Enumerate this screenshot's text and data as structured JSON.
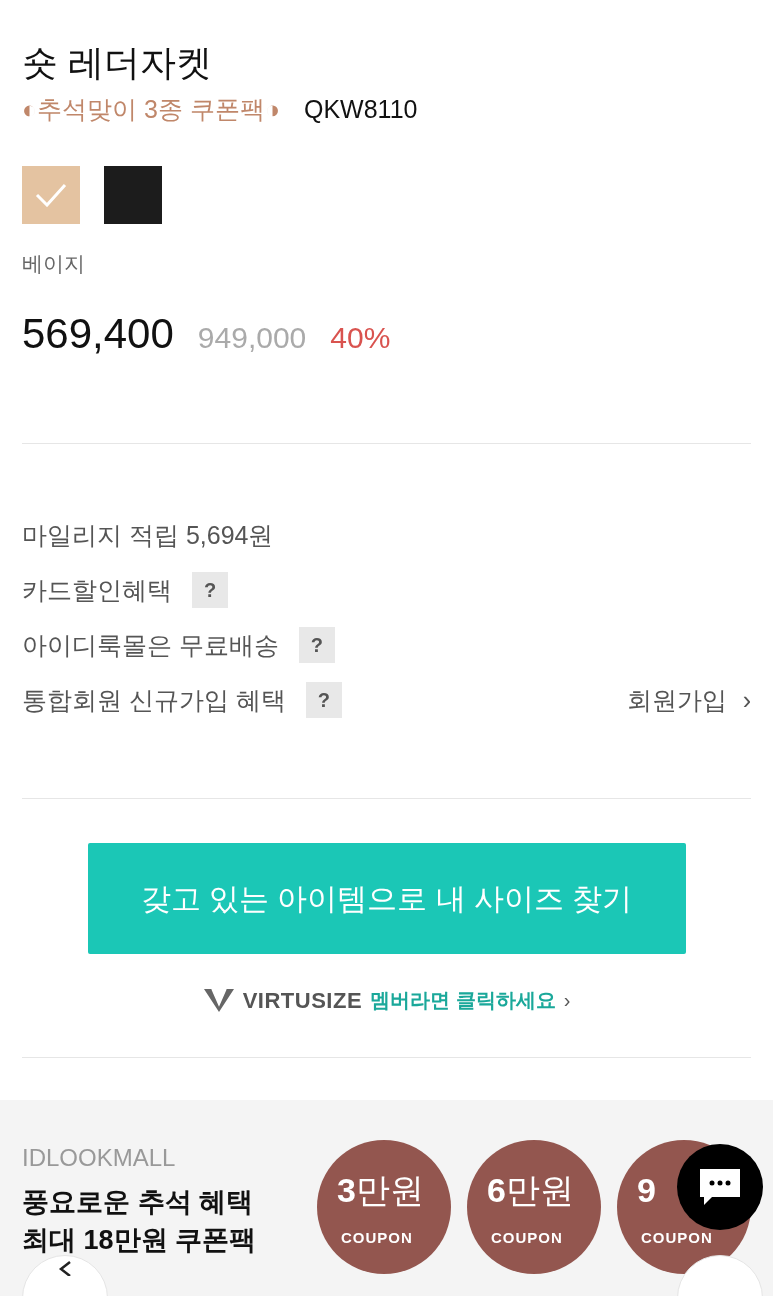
{
  "product": {
    "title": "숏 레더자켓",
    "promo": "◐추석맞이 3종 쿠폰팩◑",
    "code": "QKW8110"
  },
  "swatches": [
    {
      "color": "#e4c3a1",
      "selected": true
    },
    {
      "color": "#1c1c1c",
      "selected": false
    }
  ],
  "color_label": "베이지",
  "price": {
    "sale": "569,400",
    "original": "949,000",
    "discount": "40%"
  },
  "benefits": [
    {
      "text": "마일리지 적립 5,694원"
    },
    {
      "text": "카드할인혜택",
      "help_text": "?"
    },
    {
      "text": "아이디룩몰은 무료배송",
      "help_text": "?"
    },
    {
      "text": "통합회원 신규가입 혜택",
      "help_text": "?",
      "link": "회원가입",
      "link_arrow": "›"
    }
  ],
  "size_button": "갖고 있는 아이템으로 내 사이즈 찾기",
  "virtusize": {
    "brand": "VIRTUSIZE",
    "cta": "멤버라면 클릭하세요",
    "arrow": "›"
  },
  "banner": {
    "brand": "IDLOOKMALL",
    "headline": [
      "풍요로운 추석 혜택",
      "최대 **18**만원 쿠폰팩"
    ],
    "coupons": [
      {
        "amount": "**3**만원",
        "label": "COUPON"
      },
      {
        "amount": "**6**만원",
        "label": "COUPON"
      },
      {
        "amount": "**9**",
        "label": "COUPON"
      }
    ]
  }
}
